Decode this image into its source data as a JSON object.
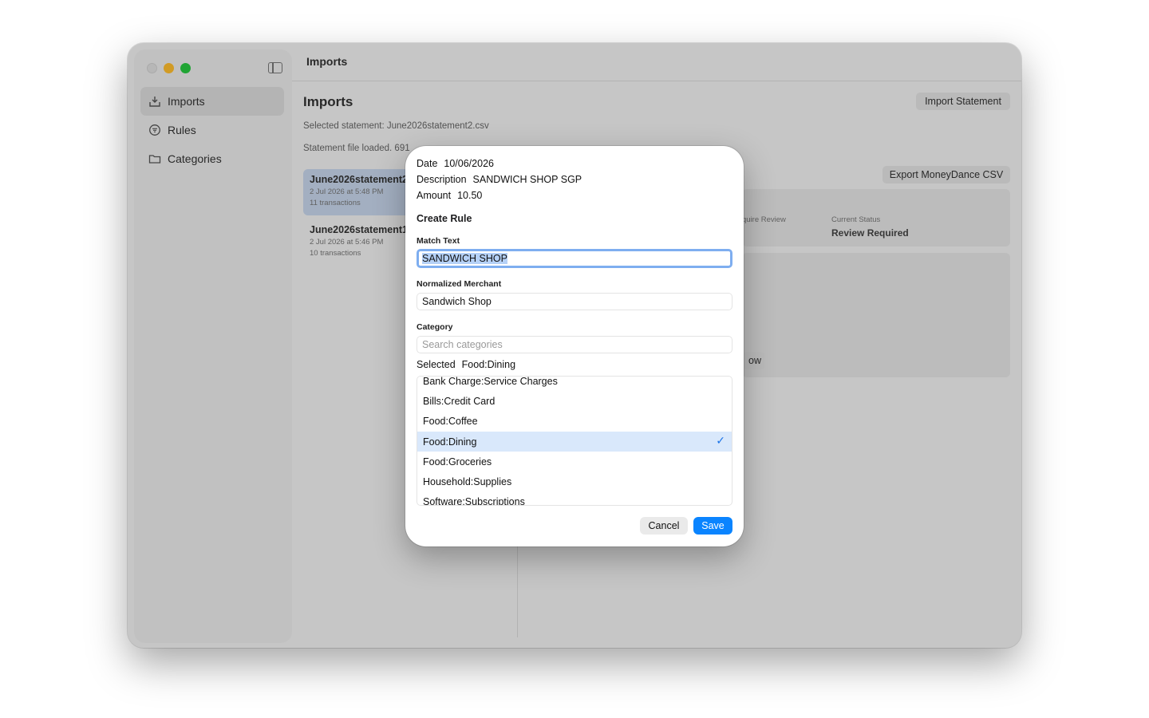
{
  "window": {
    "title": "Imports"
  },
  "sidebar": {
    "items": [
      {
        "label": "Imports",
        "icon": "tray-download-icon"
      },
      {
        "label": "Rules",
        "icon": "filter-icon"
      },
      {
        "label": "Categories",
        "icon": "folder-icon"
      }
    ]
  },
  "main": {
    "heading": "Imports",
    "import_button": "Import Statement",
    "export_button": "Export MoneyDance CSV",
    "selected_statement": "Selected statement: June2026statement2.csv",
    "loaded_text": "Statement file loaded. 691",
    "statements": [
      {
        "name": "June2026statement2.csv",
        "date": "2 Jul 2026 at 5:48 PM",
        "count": "11 transactions"
      },
      {
        "name": "June2026statement1.csv",
        "date": "2 Jul 2026 at 5:46 PM",
        "count": "10 transactions"
      }
    ],
    "status": {
      "require_review_label": "quire Review",
      "current_status_label": "Current Status",
      "current_status_value": "Review Required"
    },
    "partial_button": "ow"
  },
  "dialog": {
    "date_label": "Date",
    "date_value": "10/06/2026",
    "description_label": "Description",
    "description_value": "SANDWICH SHOP SGP",
    "amount_label": "Amount",
    "amount_value": "10.50",
    "section_title": "Create Rule",
    "match_text_label": "Match Text",
    "match_text_value": "SANDWICH SHOP",
    "normalized_merchant_label": "Normalized Merchant",
    "normalized_merchant_value": "Sandwich Shop",
    "category_label": "Category",
    "category_search_placeholder": "Search categories",
    "selected_label": "Selected",
    "selected_value": "Food:Dining",
    "categories": [
      "Bank Charge:Service Charges",
      "Bills:Credit Card",
      "Food:Coffee",
      "Food:Dining",
      "Food:Groceries",
      "Household:Supplies",
      "Software:Subscriptions"
    ],
    "cancel_label": "Cancel",
    "save_label": "Save",
    "accent_color": "#0a84ff"
  }
}
